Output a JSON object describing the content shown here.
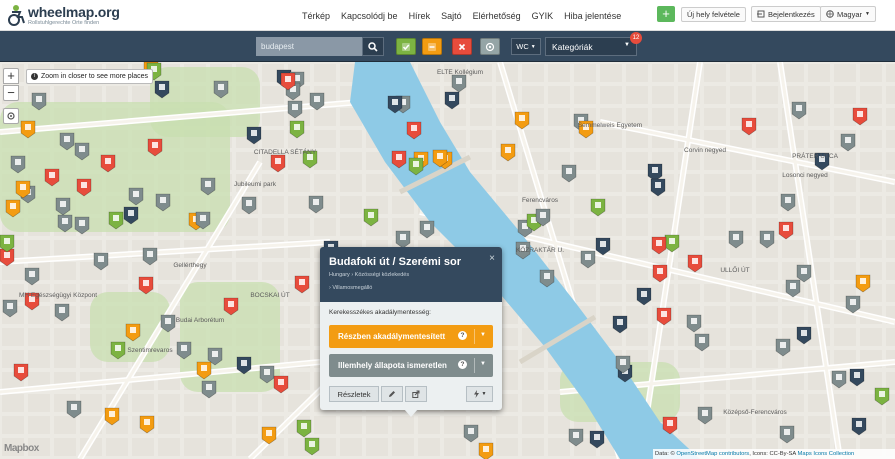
{
  "brand": {
    "name": "wheelmap.org",
    "subtitle": "Rollstuhlgerechte Orte finden"
  },
  "nav": {
    "items": [
      "Térkép",
      "Kapcsolódj be",
      "Hírek",
      "Sajtó",
      "Elérhetőség",
      "GYIK",
      "Hiba jelentése"
    ],
    "add_place": "Új hely felvétele",
    "login": "Bejelentkezés",
    "language": "Magyar"
  },
  "toolbar": {
    "search_value": "budapest",
    "wc_label": "WC",
    "category_label": "Kategóriák",
    "category_badge": "12",
    "filter_colors": {
      "green": "#7cb342",
      "orange": "#f39c12",
      "red": "#e74c3c",
      "grey": "#95a5a6"
    }
  },
  "map": {
    "zoom_in": "+",
    "zoom_out": "−",
    "zoom_hint": "Zoom in closer to see more places",
    "labels": [
      "Gellérthegy",
      "Jubileumi park",
      "Budai Arborétum",
      "Szentimrevaros",
      "Ferencváros",
      "Corvin negyed",
      "Losonci negyed",
      "CITADELLA SÉTÁNY",
      "ELTE Kollégium",
      "Középső-Ferencváros",
      "MH Egészségügyi Központ",
      "Semmelweis Egyetem",
      "PRÁTER UTCA",
      "ULLŐI ÚT",
      "BOCSKAI ÚT",
      "KÖZRAKTÁR U."
    ],
    "colors": {
      "river": "#8ecae6",
      "park": "#c8dfb0",
      "road": "#ffffff",
      "block": "#e2ddd5"
    }
  },
  "popup": {
    "title": "Budafoki út / Szerémi sor",
    "breadcrumb": "Hungary › Közösségi közlekedés",
    "category": "Villamosmegálló",
    "close": "×",
    "access_label": "Kerekesszékes akadálymentesség:",
    "status_partial": "Részben akadálymentesített",
    "status_unknown": "Illemhely állapota ismeretlen",
    "details": "Részletek",
    "help": "?"
  },
  "attribution": {
    "prefix": "Data: ©",
    "osm": "OpenStreetMap contributors",
    "icons": ", Icons: CC-By-SA",
    "maps_icons": "Maps Icons Collection"
  },
  "scale_text": "Mapbox"
}
